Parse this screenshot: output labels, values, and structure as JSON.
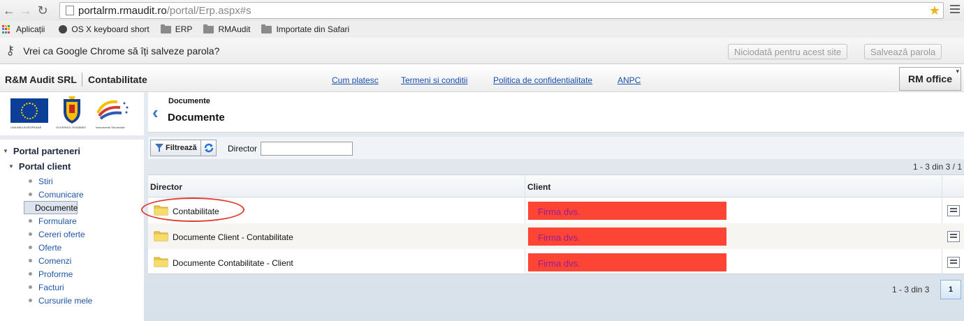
{
  "browser": {
    "url_host": "portalrm.rmaudit.ro",
    "url_path": "/portal/Erp.aspx#s",
    "bookmarks": [
      {
        "label": "Aplicații"
      },
      {
        "label": "OS X keyboard short"
      },
      {
        "label": "ERP"
      },
      {
        "label": "RMAudit"
      },
      {
        "label": "Importate din Safari"
      }
    ],
    "infobar": {
      "message": "Vrei ca Google Chrome să îți salveze parola?",
      "never_label": "Niciodată pentru acest site",
      "save_label": "Salvează parola"
    }
  },
  "header": {
    "company": "R&M Audit SRL",
    "module": "Contabilitate",
    "links": [
      "Cum platesc",
      "Termeni si conditii",
      "Politica de confidentialitate",
      "ANPC"
    ],
    "office_button": "RM office"
  },
  "sidebar": {
    "logos": [
      "UNIUNEA EUROPEANĂ",
      "GUVERNUL ROMÂNIEI",
      "Instrumente Structurale"
    ],
    "root": "Portal parteneri",
    "group": "Portal client",
    "items": [
      "Stiri",
      "Comunicare",
      "Documente",
      "Formulare",
      "Cereri oferte",
      "Oferte",
      "Comenzi",
      "Proforme",
      "Facturi",
      "Cursurile mele"
    ],
    "selected": "Documente"
  },
  "content": {
    "breadcrumb": "Documente",
    "title": "Documente",
    "filter": {
      "button_label": "Filtrează",
      "field_label": "Director",
      "field_value": ""
    },
    "count_top": "1 - 3 din 3 /  1",
    "columns": [
      "Director",
      "Client"
    ],
    "rows": [
      {
        "director": "Contabilitate",
        "client": "Firma dvs."
      },
      {
        "director": "Documente Client - Contabilitate",
        "client": "Firma dvs."
      },
      {
        "director": "Documente Contabilitate - Client",
        "client": "Firma dvs."
      }
    ],
    "pager": {
      "text": "1 - 3 din 3",
      "page": "1"
    }
  },
  "colors": {
    "accent_link": "#1a4ea8",
    "client_badge": "#fd4535",
    "client_text": "#9a1d98",
    "highlight": "#e23a2e"
  }
}
